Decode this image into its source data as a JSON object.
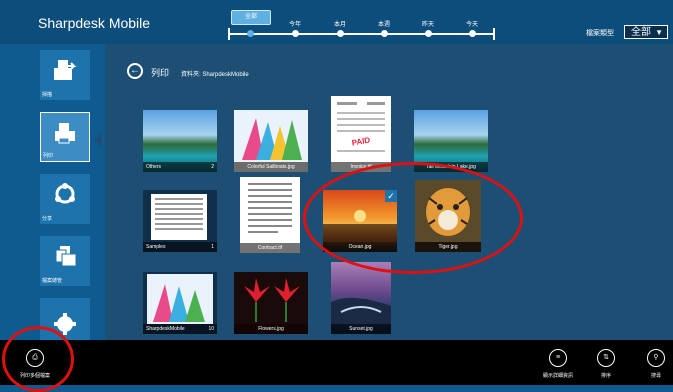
{
  "app": {
    "title": "Sharpdesk Mobile"
  },
  "timeline": {
    "selected": "全部",
    "labels": [
      "今年",
      "本月",
      "本週",
      "昨天",
      "今天"
    ]
  },
  "file_type": {
    "label": "檔案類型",
    "value": "全部"
  },
  "sidebar": {
    "items": [
      {
        "label": "掃描"
      },
      {
        "label": "列印"
      },
      {
        "label": "分享"
      },
      {
        "label": "檔案總管"
      }
    ]
  },
  "breadcrumb": {
    "title": "列印",
    "folder": "資料夾: SharpdeskMobile"
  },
  "tiles": [
    {
      "name": "Others",
      "count": "2"
    },
    {
      "name": "Colorful Sailboats.jpg"
    },
    {
      "name": "Invoice.tif",
      "stamp": "PAID"
    },
    {
      "name": "Tall Mountain Lake.jpg"
    },
    {
      "name": "Samples",
      "count": "1"
    },
    {
      "name": "Contract.tif"
    },
    {
      "name": "Ocean.jpg"
    },
    {
      "name": "Tiger.jpg"
    },
    {
      "name": "SharpdeskMobile",
      "count": "10"
    },
    {
      "name": "Flowers.jpg"
    },
    {
      "name": "Sunset.jpg"
    }
  ],
  "appbar": {
    "left": {
      "label": "列印多個檔案"
    },
    "right": [
      {
        "label": "顯示詳細資訊"
      },
      {
        "label": "排序"
      },
      {
        "label": "搜尋"
      }
    ]
  },
  "colors": {
    "accent": "#1e73ad",
    "highlight": "#e01010",
    "content_bg": "#1d4f75"
  }
}
